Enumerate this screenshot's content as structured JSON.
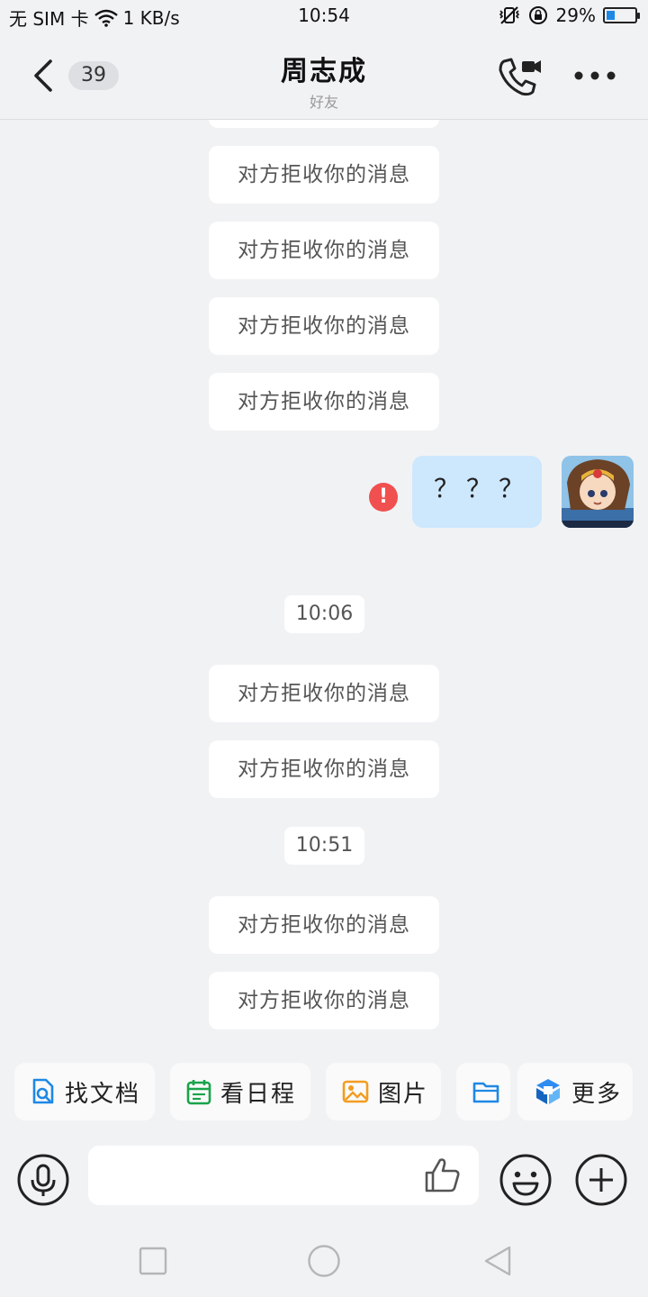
{
  "status_bar": {
    "carrier": "无 SIM 卡",
    "speed": "1 KB/s",
    "time": "10:54",
    "battery": "29%",
    "battery_level": 0.29
  },
  "header": {
    "unread_count": "39",
    "title": "周志成",
    "subtitle": "好友"
  },
  "messages": {
    "rejected_text": "对方拒收你的消息",
    "my_message": "？？？",
    "error_mark": "!",
    "time_1": "10:06",
    "time_2": "10:51"
  },
  "quick_actions": {
    "find_docs": "找文档",
    "schedule": "看日程",
    "pictures": "图片",
    "more": "更多"
  },
  "input": {
    "placeholder": ""
  },
  "icons": [
    "back-icon",
    "phone-video-icon",
    "more-icon",
    "error-icon",
    "doc-search-icon",
    "calendar-icon",
    "image-icon",
    "folder-icon",
    "tencent-docs-icon",
    "mic-icon",
    "thumb-up-icon",
    "emoji-icon",
    "plus-icon",
    "nav-square-icon",
    "nav-home-icon",
    "nav-back-icon"
  ],
  "colors": {
    "accent": "#1e88e5",
    "bubble_blue": "#cde7fd",
    "error_red": "#f0504f",
    "background": "#f1f2f4"
  }
}
